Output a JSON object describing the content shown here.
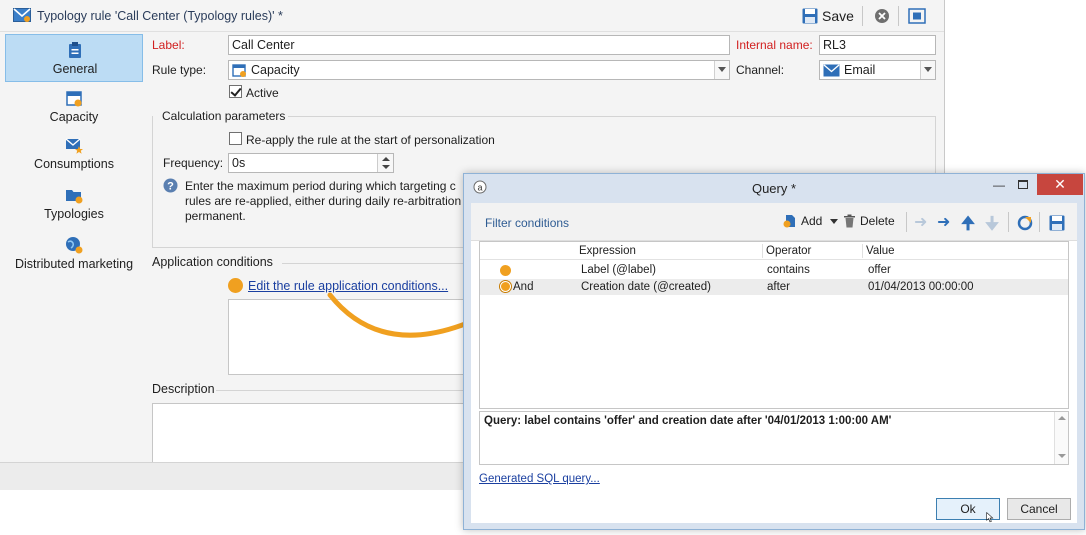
{
  "main_window": {
    "title": "Typology rule 'Call Center (Typology rules)' *",
    "toolbar": {
      "save_label": "Save"
    },
    "sidebar": {
      "items": [
        {
          "label": "General",
          "icon": "clipboard-icon",
          "active": true
        },
        {
          "label": "Capacity",
          "icon": "calendar-icon",
          "active": false
        },
        {
          "label": "Consumptions",
          "icon": "envelope-star-icon",
          "active": false
        },
        {
          "label": "Typologies",
          "icon": "folder-icon",
          "active": false
        },
        {
          "label": "Distributed marketing",
          "icon": "globe-icon",
          "active": false
        }
      ]
    },
    "form": {
      "label_label": "Label:",
      "label_value": "Call Center",
      "internal_name_label": "Internal name:",
      "internal_name_value": "RL3",
      "rule_type_label": "Rule type:",
      "rule_type_value": "Capacity",
      "channel_label": "Channel:",
      "channel_value": "Email",
      "active_label": "Active",
      "active_checked": true
    },
    "calc": {
      "title": "Calculation parameters",
      "reapply_label": "Re-apply the rule at the start of personalization",
      "reapply_checked": false,
      "frequency_label": "Frequency:",
      "frequency_value": "0s",
      "help_line1": "Enter the maximum period during which targeting c",
      "help_line2": "rules are re-applied, either during daily re-arbitration",
      "help_line3": "permanent."
    },
    "application": {
      "title": "Application conditions",
      "link": "Edit the rule application conditions..."
    },
    "description": {
      "title": "Description"
    }
  },
  "query_dialog": {
    "title": "Query *",
    "filter_title": "Filter conditions",
    "toolbar": {
      "add_label": "Add",
      "delete_label": "Delete"
    },
    "columns": {
      "expression": "Expression",
      "operator": "Operator",
      "value": "Value"
    },
    "rows": [
      {
        "prefix": "",
        "expression": "Label (@label)",
        "operator": "contains",
        "value": "offer"
      },
      {
        "prefix": "And",
        "expression": "Creation date (@created)",
        "operator": "after",
        "value": "01/04/2013 00:00:00"
      }
    ],
    "summary": "Query: label contains 'offer' and creation date after '04/01/2013 1:00:00 AM'",
    "sql_link": "Generated SQL query...",
    "ok_label": "Ok",
    "cancel_label": "Cancel"
  },
  "colors": {
    "accent_orange": "#f0a020",
    "link_blue": "#1a3fa0",
    "active_blue": "#bcdcf4",
    "close_red": "#c7463e"
  }
}
